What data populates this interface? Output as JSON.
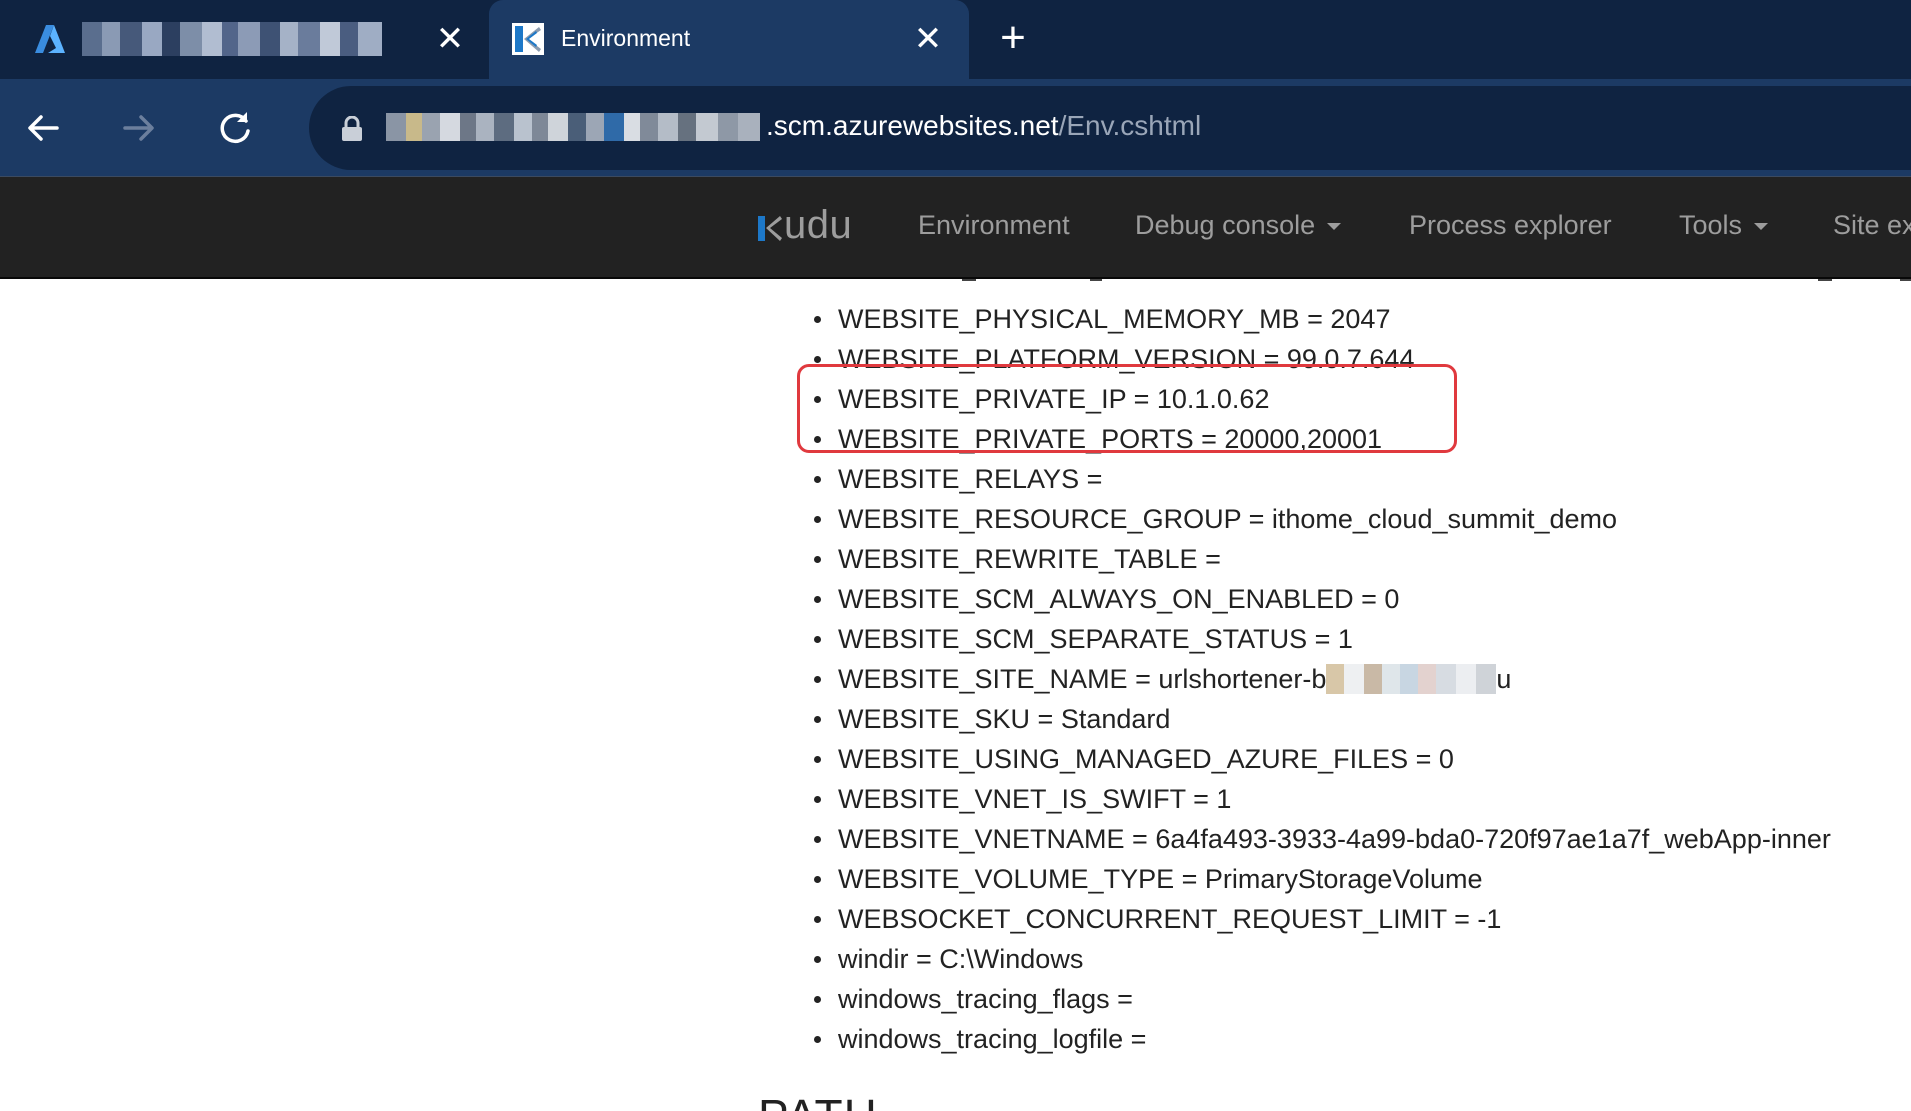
{
  "browser": {
    "tabs": [
      {
        "title": "",
        "icon": "azure-logo-icon",
        "active": false
      },
      {
        "title": "Environment",
        "icon": "kudu-favicon-icon",
        "active": true
      }
    ],
    "address": {
      "host_suffix": ".scm.azurewebsites.net",
      "path": "/Env.cshtml"
    }
  },
  "kudu": {
    "brand": "udu",
    "nav": [
      {
        "label": "Environment",
        "dropdown": false
      },
      {
        "label": "Debug console",
        "dropdown": true
      },
      {
        "label": "Process explorer",
        "dropdown": false
      },
      {
        "label": "Tools",
        "dropdown": true
      },
      {
        "label": "Site ex",
        "dropdown": false
      }
    ]
  },
  "environment": {
    "items": [
      "WEBSITE_PHYSICAL_MEMORY_MB = 2047",
      "WEBSITE_PLATFORM_VERSION = 99.0.7.644",
      "WEBSITE_PRIVATE_IP = 10.1.0.62",
      "WEBSITE_PRIVATE_PORTS = 20000,20001",
      "WEBSITE_RELAYS =",
      "WEBSITE_RESOURCE_GROUP = ithome_cloud_summit_demo",
      "WEBSITE_REWRITE_TABLE =",
      "WEBSITE_SCM_ALWAYS_ON_ENABLED = 0",
      "WEBSITE_SCM_SEPARATE_STATUS = 1",
      "WEBSITE_SITE_NAME = urlshortener-b",
      "WEBSITE_SKU = Standard",
      "WEBSITE_USING_MANAGED_AZURE_FILES = 0",
      "WEBSITE_VNET_IS_SWIFT = 1",
      "WEBSITE_VNETNAME = 6a4fa493-3933-4a99-bda0-720f97ae1a7f_webApp-inner",
      "WEBSITE_VOLUME_TYPE = PrimaryStorageVolume",
      "WEBSOCKET_CONCURRENT_REQUEST_LIMIT = -1",
      "windir = C:\\Windows",
      "windows_tracing_flags =",
      "windows_tracing_logfile ="
    ],
    "site_name_tail": "u",
    "next_heading": "PATH"
  },
  "colors": {
    "tab_strip": "#0f2341",
    "toolbar": "#1c3a64",
    "kudu_nav": "#222222",
    "highlight": "#e0393e"
  }
}
